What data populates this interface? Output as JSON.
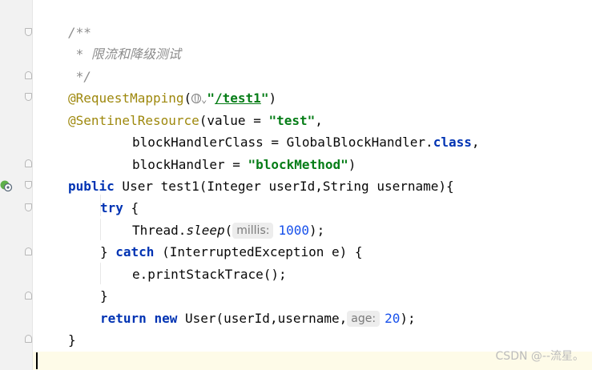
{
  "editor": {
    "lines": {
      "l1": "/**",
      "l2": " * 限流和降级测试",
      "l3": " */",
      "l4_ann": "@RequestMapping",
      "l4_open": "(",
      "l4_chevron": "⌄",
      "l4_q1": "\"",
      "l4_path": "/test1",
      "l4_q2": "\"",
      "l4_close": ")",
      "l5_ann": "@SentinelResource",
      "l5_a": "(value = ",
      "l5_str": "\"test\"",
      "l5_b": ",",
      "l6_a": "blockHandlerClass = GlobalBlockHandler.",
      "l6_kw": "class",
      "l6_b": ",",
      "l7_a": "blockHandler = ",
      "l7_str": "\"blockMethod\"",
      "l7_b": ")",
      "l8_kw": "public",
      "l8_a": " User test1(Integer userId,String username){",
      "l9_kw": "try",
      "l9_a": " {",
      "l10_a": "Thread.",
      "l10_it": "sleep",
      "l10_b": "(",
      "l10_hint": "millis:",
      "l10_num": "1000",
      "l10_c": ");",
      "l11_a": "} ",
      "l11_kw": "catch",
      "l11_b": " (InterruptedException e) {",
      "l12_a": "e.printStackTrace();",
      "l13_a": "}",
      "l14_kw1": "return",
      "l14_sp": " ",
      "l14_kw2": "new",
      "l14_a": " User(userId,username,",
      "l14_hint": "age:",
      "l14_num": "20",
      "l14_b": ");",
      "l15_a": "}"
    }
  },
  "watermark": "CSDN @--流星。",
  "colors": {
    "keyword": "#0033b3",
    "annotation": "#9e880d",
    "string": "#067d17",
    "comment": "#8c8c8c",
    "number": "#1750eb"
  }
}
